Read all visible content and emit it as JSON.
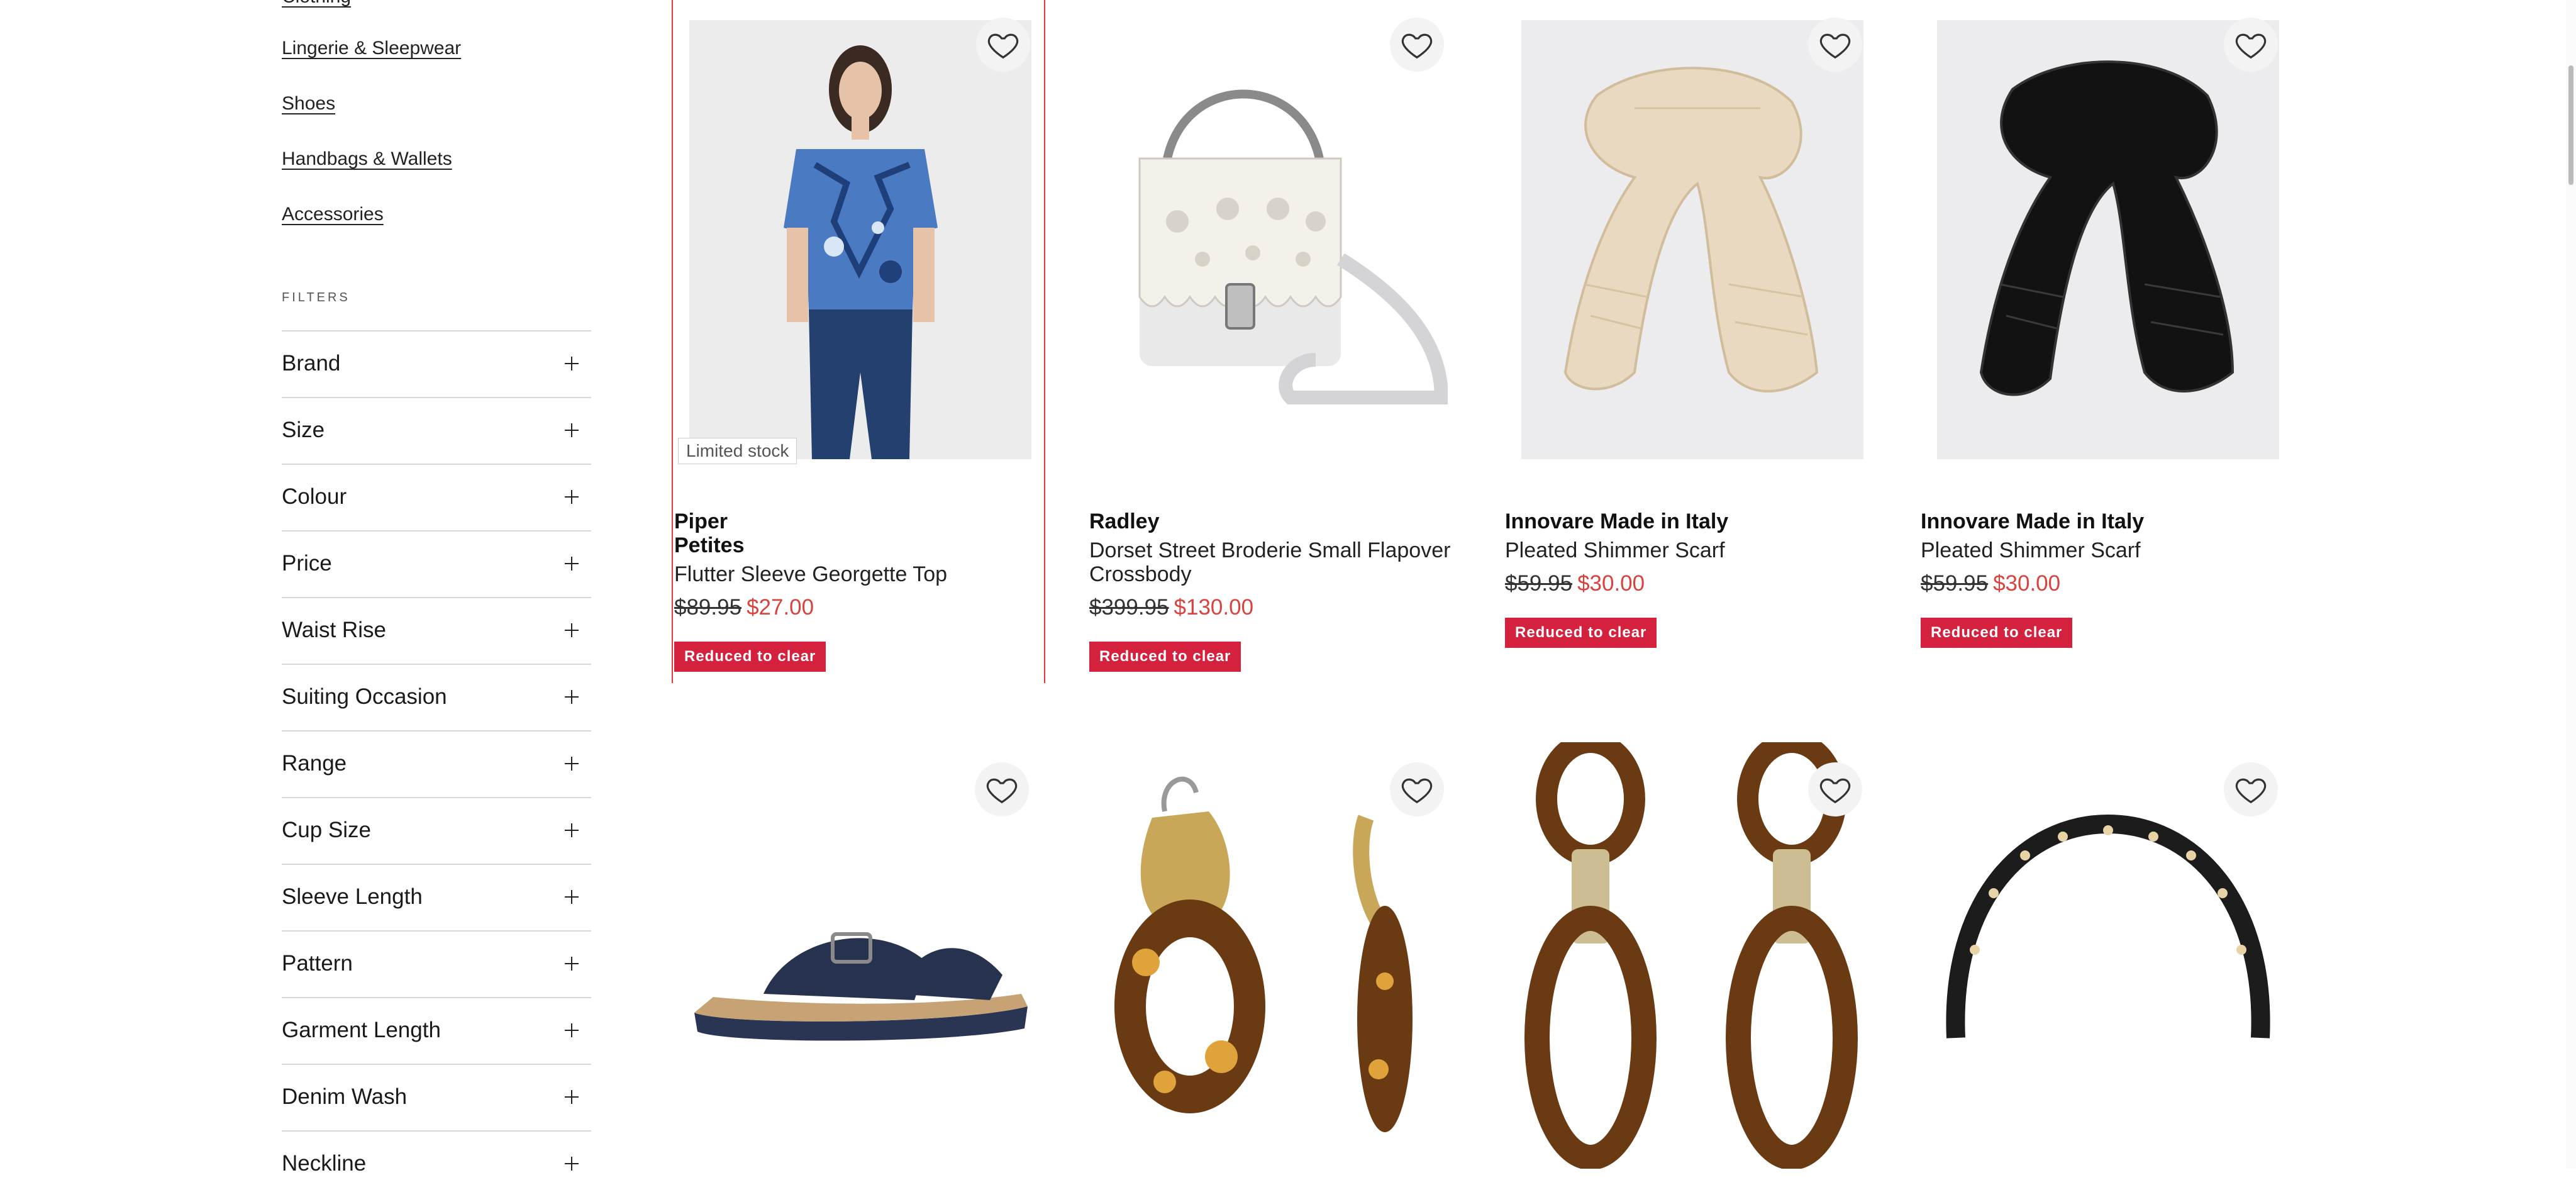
{
  "categories": [
    {
      "label": "Clothing"
    },
    {
      "label": "Lingerie & Sleepwear"
    },
    {
      "label": "Shoes"
    },
    {
      "label": "Handbags & Wallets"
    },
    {
      "label": "Accessories"
    }
  ],
  "filters": {
    "heading": "FILTERS",
    "items": [
      {
        "label": "Brand"
      },
      {
        "label": "Size"
      },
      {
        "label": "Colour"
      },
      {
        "label": "Price"
      },
      {
        "label": "Waist Rise"
      },
      {
        "label": "Suiting Occasion"
      },
      {
        "label": "Range"
      },
      {
        "label": "Cup Size"
      },
      {
        "label": "Sleeve Length"
      },
      {
        "label": "Pattern"
      },
      {
        "label": "Garment Length"
      },
      {
        "label": "Denim Wash"
      },
      {
        "label": "Neckline"
      }
    ]
  },
  "products": [
    {
      "brand": "Piper",
      "brand_line2": "Petites",
      "name": "Flutter Sleeve Georgette Top",
      "was": "$89.95",
      "now": "$27.00",
      "badge": "Reduced to clear",
      "stock": "Limited stock"
    },
    {
      "brand": "Radley",
      "name_line1": "Dorset Street Broderie Small Flapover",
      "name_line2": "Crossbody",
      "was": "$399.95",
      "now": "$130.00",
      "badge": "Reduced to clear"
    },
    {
      "brand": "Innovare Made in Italy",
      "name": "Pleated Shimmer Scarf",
      "was": "$59.95",
      "now": "$30.00",
      "badge": "Reduced to clear"
    },
    {
      "brand": "Innovare Made in Italy",
      "name": "Pleated Shimmer Scarf",
      "was": "$59.95",
      "now": "$30.00",
      "badge": "Reduced to clear"
    }
  ],
  "colors": {
    "accent": "#d4213d",
    "sale": "#d9433f",
    "highlight_border": "#e0383b"
  },
  "icons": {
    "wishlist": "heart-icon",
    "expand": "plus-icon"
  }
}
